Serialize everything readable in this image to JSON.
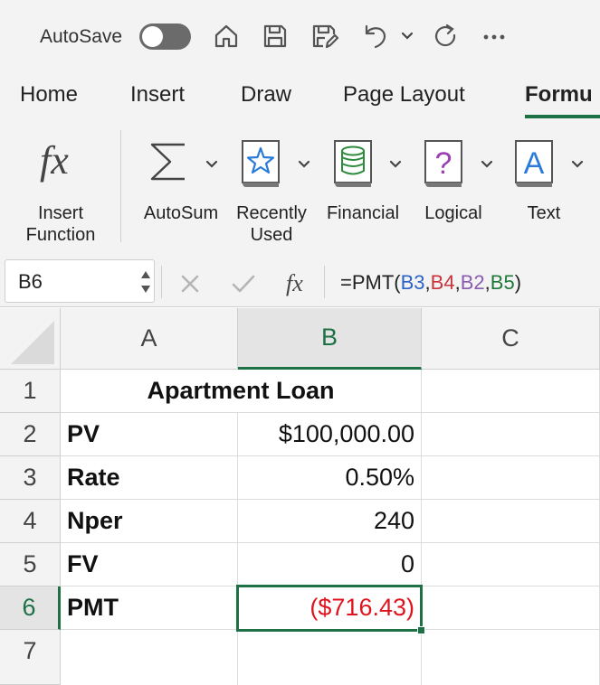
{
  "quick_access": {
    "autosave_label": "AutoSave",
    "autosave_on": false,
    "icons": [
      "home-icon",
      "save-icon",
      "save-edit-icon",
      "undo-icon",
      "redo-icon",
      "more-icon"
    ]
  },
  "tabs": [
    {
      "label": "Home",
      "active": false
    },
    {
      "label": "Insert",
      "active": false
    },
    {
      "label": "Draw",
      "active": false
    },
    {
      "label": "Page Layout",
      "active": false
    },
    {
      "label": "Formu",
      "active": true
    }
  ],
  "ribbon": {
    "insert_function": {
      "line1": "Insert",
      "line2": "Function"
    },
    "autosum": {
      "label": "AutoSum"
    },
    "recently_used": {
      "line1": "Recently",
      "line2": "Used"
    },
    "financial": {
      "label": "Financial"
    },
    "logical": {
      "label": "Logical"
    },
    "text": {
      "label": "Text"
    }
  },
  "formula_bar": {
    "name_box": "B6",
    "formula_prefix": "=PMT(",
    "ref1": "B3",
    "ref2": "B4",
    "ref3": "B2",
    "ref4": "B5",
    "comma": ",",
    "formula_suffix": ")"
  },
  "sheet": {
    "columns": [
      "A",
      "B",
      "C"
    ],
    "selected_column": "B",
    "rows": [
      "1",
      "2",
      "3",
      "4",
      "5",
      "6",
      "7"
    ],
    "selected_row": "6",
    "title": "Apartment Loan",
    "data": [
      {
        "label": "PV",
        "value": "$100,000.00"
      },
      {
        "label": "Rate",
        "value": "0.50%"
      },
      {
        "label": "Nper",
        "value": "240"
      },
      {
        "label": "FV",
        "value": "0"
      },
      {
        "label": "PMT",
        "value": "($716.43)"
      }
    ],
    "negative_color": "#e0141e",
    "accent_color": "#1e7145"
  }
}
